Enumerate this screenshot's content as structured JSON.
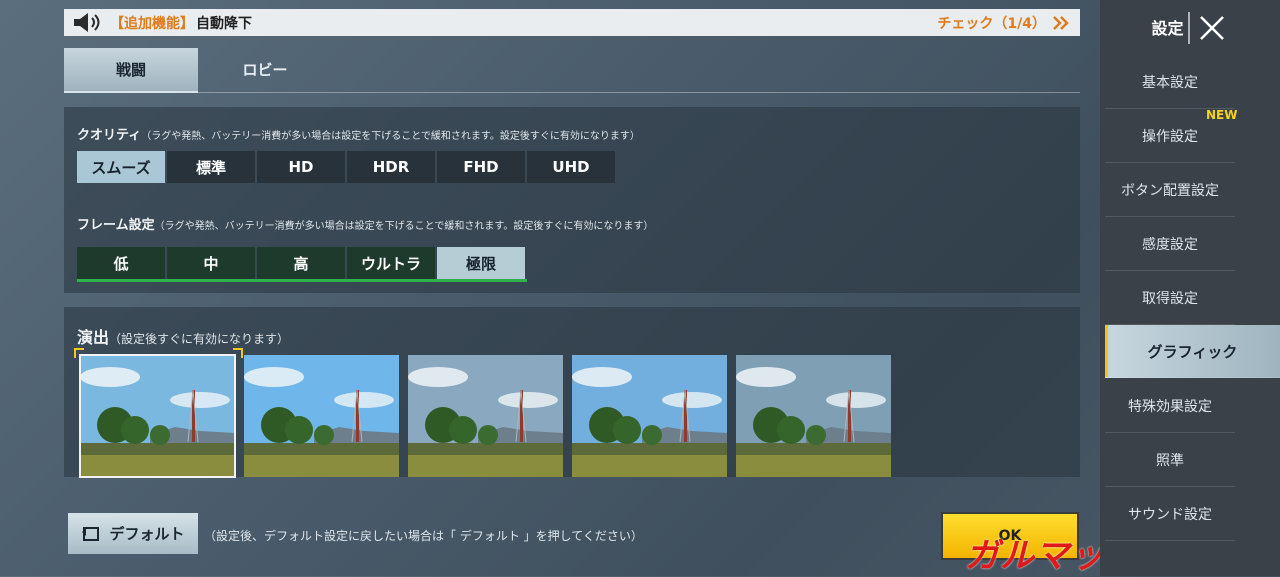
{
  "notice": {
    "tag": "【追加機能】",
    "text": "自動降下",
    "check": "チェック（1/4）"
  },
  "tabs": [
    {
      "label": "戦闘",
      "active": true
    },
    {
      "label": "ロビー",
      "active": false
    }
  ],
  "quality": {
    "title": "クオリティ",
    "note": "（ラグや発熱、バッテリー消費が多い場合は設定を下げることで緩和されます。設定後すぐに有効になります）",
    "options": [
      "スムーズ",
      "標準",
      "HD",
      "HDR",
      "FHD",
      "UHD"
    ],
    "selected": "スムーズ"
  },
  "frame": {
    "title": "フレーム設定",
    "note": "（ラグや発熱、バッテリー消費が多い場合は設定を下げることで緩和されます。設定後すぐに有効になります）",
    "options": [
      "低",
      "中",
      "高",
      "ウルトラ",
      "極限"
    ],
    "selected": "極限"
  },
  "style": {
    "title": "演出",
    "note": "（設定後すぐに有効になります）",
    "thumbnails": 5,
    "selected_index": 0
  },
  "footer": {
    "default_label": "デフォルト",
    "default_note": "（設定後、デフォルト設定に戻したい場合は「 デフォルト 」を押してください）",
    "ok_label": "OK"
  },
  "watermark": "ガルマックス",
  "sidebar": {
    "title": "設定",
    "items": [
      {
        "label": "基本設定"
      },
      {
        "label": "操作設定",
        "badge": "NEW"
      },
      {
        "label": "ボタン配置設定"
      },
      {
        "label": "感度設定"
      },
      {
        "label": "取得設定"
      },
      {
        "label": "グラフィック",
        "active": true
      },
      {
        "label": "特殊効果設定"
      },
      {
        "label": "照準"
      },
      {
        "label": "サウンド設定"
      }
    ]
  },
  "colors": {
    "accent_orange": "#e07a1a",
    "selected_blue": "#a9c7d4",
    "frame_green": "#2fb24a",
    "ok_yellow": "#f3b300",
    "new_badge": "#f5d21b"
  }
}
